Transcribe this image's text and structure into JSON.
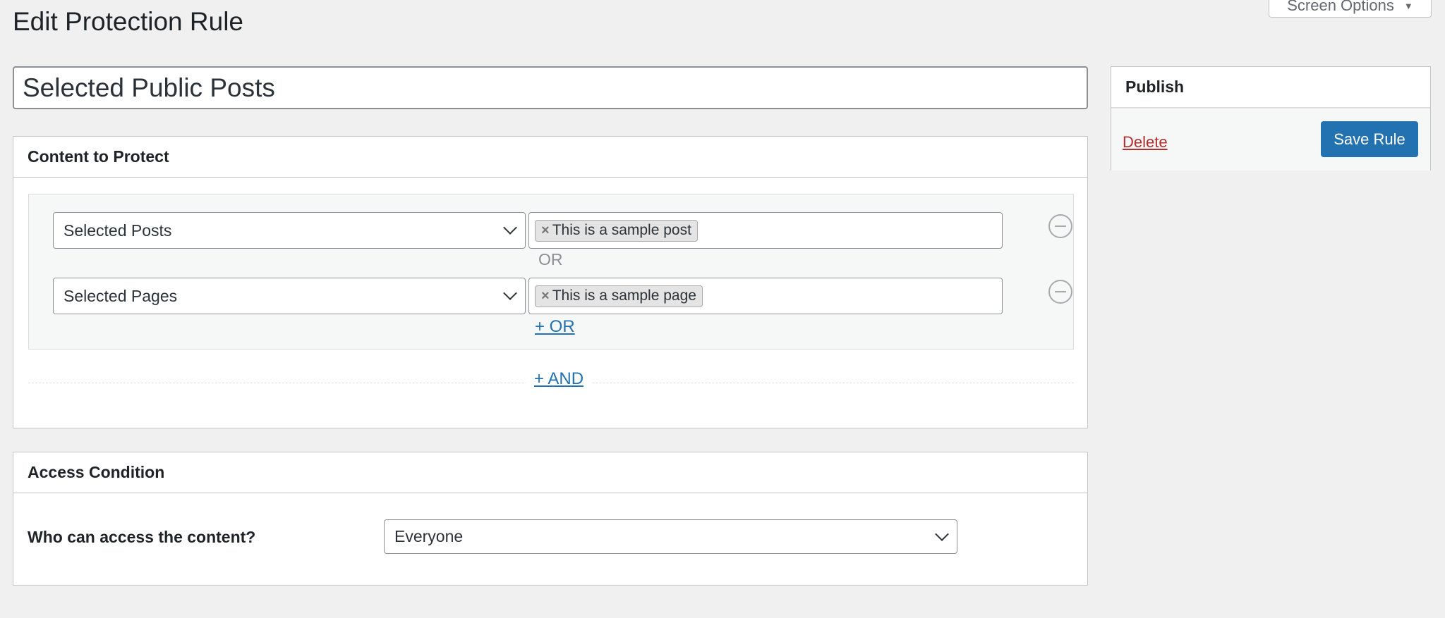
{
  "header": {
    "title": "Edit Protection Rule",
    "screen_options": "Screen Options"
  },
  "rule": {
    "title_value": "Selected Public Posts"
  },
  "content_to_protect": {
    "heading": "Content to Protect",
    "rules": [
      {
        "type": "Selected Posts",
        "tag": "This is a sample post"
      },
      {
        "type": "Selected Pages",
        "tag": "This is a sample page"
      }
    ],
    "or_label": "OR",
    "add_or": "+ OR",
    "add_and": "+ AND"
  },
  "access_condition": {
    "heading": "Access Condition",
    "question": "Who can access the content?",
    "selected": "Everyone"
  },
  "publish": {
    "heading": "Publish",
    "delete_label": "Delete",
    "save_label": "Save Rule"
  },
  "colors": {
    "primary": "#2271b1",
    "danger": "#b32d2e",
    "background": "#f0f0f1"
  }
}
